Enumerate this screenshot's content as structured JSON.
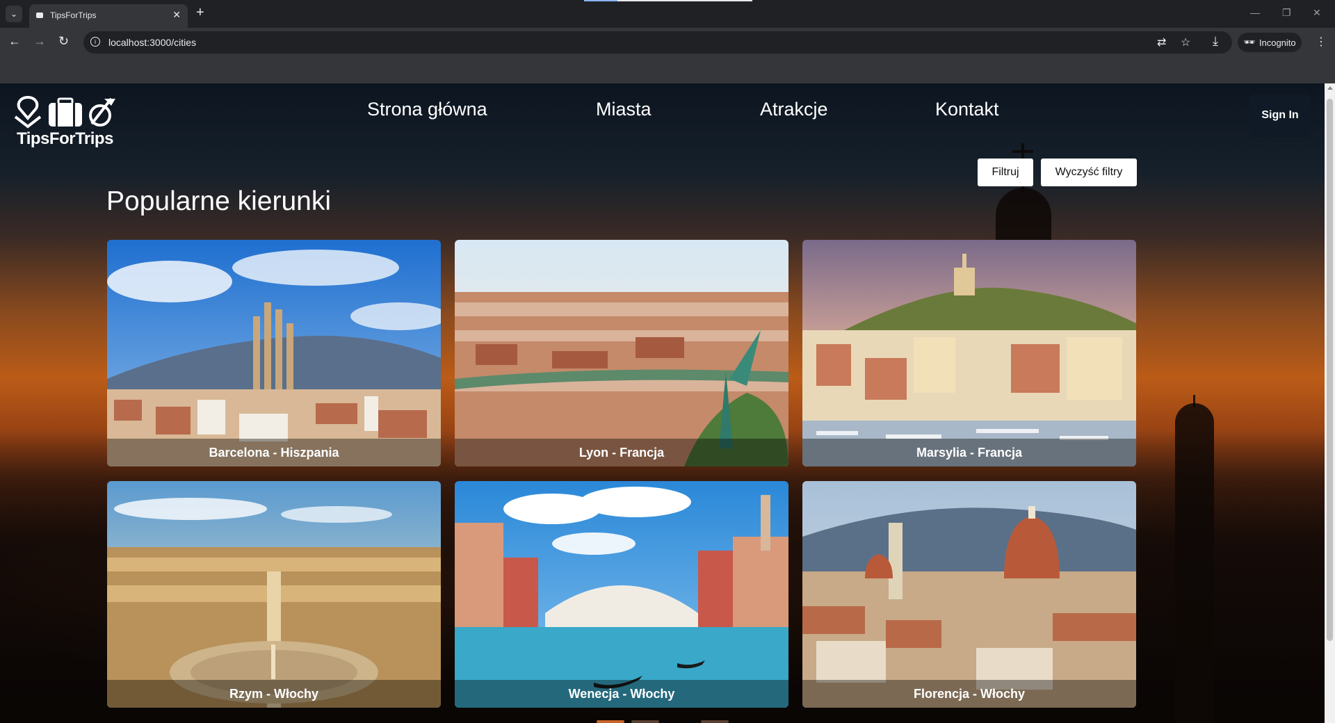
{
  "browser": {
    "tab_title": "TipsForTrips",
    "tab_menu_icon": "chevron-down-icon",
    "url": "localhost:3000/cities",
    "incognito_label": "Incognito"
  },
  "site": {
    "logo_text": "TipsForTrips",
    "nav": [
      {
        "label": "Strona główna"
      },
      {
        "label": "Miasta"
      },
      {
        "label": "Atrakcje"
      },
      {
        "label": "Kontakt"
      }
    ],
    "signin_label": "Sign In"
  },
  "filters": {
    "filter_label": "Filtruj",
    "clear_label": "Wyczyść filtry"
  },
  "heading": "Popularne kierunki",
  "cities": [
    {
      "label": "Barcelona - Hiszpania"
    },
    {
      "label": "Lyon - Francja"
    },
    {
      "label": "Marsylia - Francja"
    },
    {
      "label": "Rzym - Włochy"
    },
    {
      "label": "Wenecja - Włochy"
    },
    {
      "label": "Florencja - Włochy"
    }
  ],
  "colors": {
    "signin_bg": "#0f1a26",
    "chrome_dark": "#202124",
    "chrome_mid": "#35363a"
  }
}
